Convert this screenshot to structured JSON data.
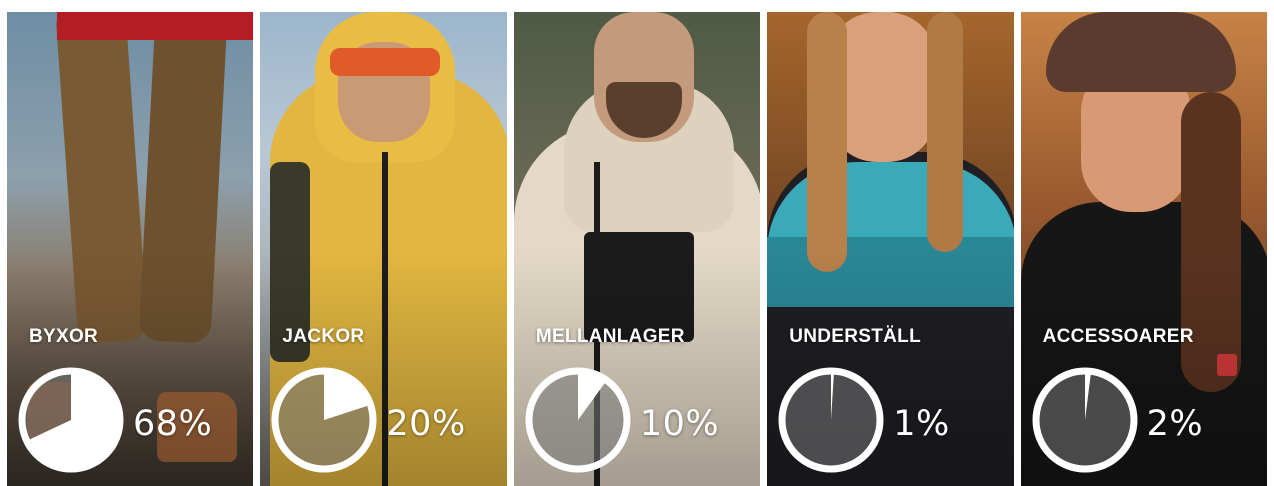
{
  "colors": {
    "ring": "#ffffff",
    "wedge": "#ffffff",
    "disc_fill": "rgba(120,120,120,0.55)"
  },
  "categories": [
    {
      "label": "BYXOR",
      "percent_text": "68%",
      "share": 0.68,
      "image": "brown-outdoor-pants-and-hiking-boots"
    },
    {
      "label": "JACKOR",
      "percent_text": "20%",
      "share": 0.2,
      "image": "man-in-yellow-rain-jacket"
    },
    {
      "label": "MELLANLAGER",
      "percent_text": "10%",
      "share": 0.1,
      "image": "man-in-beige-fleece-hoodie"
    },
    {
      "label": "UNDERSTÄLL",
      "percent_text": "1%",
      "share": 0.01,
      "image": "woman-in-patterned-base-layer-top"
    },
    {
      "label": "ACCESSOARER",
      "percent_text": "2%",
      "share": 0.02,
      "image": "woman-in-cap-and-black-tee"
    }
  ]
}
